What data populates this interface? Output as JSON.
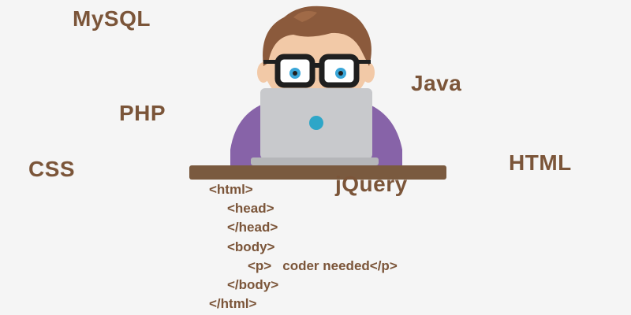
{
  "technologies": {
    "mysql": "MySQL",
    "php": "PHP",
    "css": "CSS",
    "java": "Java",
    "html": "HTML",
    "jquery": "jQuery"
  },
  "code": {
    "html_open": "<html>",
    "head_open": "<head>",
    "head_close": "</head>",
    "body_open": "<body>",
    "p_open": "<p>",
    "p_text": "coder needed</p>",
    "body_close": "</body>",
    "html_close": "</html>"
  },
  "colors": {
    "text_brown": "#7b5539",
    "hair": "#8b5a3c",
    "skin": "#f2c9a7",
    "glasses": "#1f1f1f",
    "iris": "#3aa6d8",
    "shirt": "#8763a8",
    "laptop": "#c8c9cc",
    "laptop_dot": "#2ea6c8",
    "desk": "#7a5a3f",
    "background": "#f5f5f5"
  },
  "illustration": "coder-at-laptop"
}
